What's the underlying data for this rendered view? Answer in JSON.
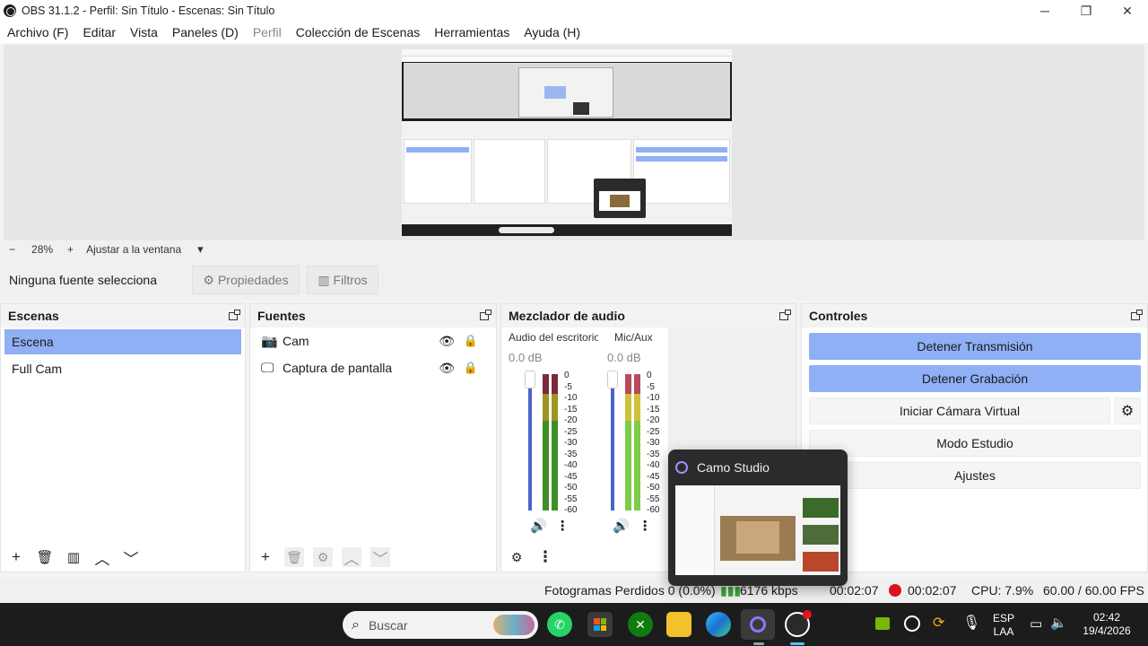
{
  "window": {
    "title": "OBS 31.1.2 - Perfil: Sin Título - Escenas: Sin Título",
    "minimize_glyph": "─",
    "maximize_glyph": "❐",
    "close_glyph": "✕"
  },
  "menu": [
    "Archivo (F)",
    "Editar",
    "Vista",
    "Paneles (D)",
    "Perfil",
    "Colección de Escenas",
    "Herramientas",
    "Ayuda (H)"
  ],
  "zoom": {
    "minus": "−",
    "value": "28%",
    "plus": "+",
    "fit_label": "Ajustar a la ventana",
    "dropdown_glyph": "▾"
  },
  "source_toolbar": {
    "label": "Ninguna fuente selecciona",
    "properties": "Propiedades",
    "filters": "Filtros"
  },
  "scenes": {
    "title": "Escenas",
    "items": [
      "Escena",
      "Full Cam"
    ],
    "selected_index": 0
  },
  "sources": {
    "title": "Fuentes",
    "items": [
      {
        "label": "Cam",
        "icon": "camera-icon"
      },
      {
        "label": "Captura de pantalla",
        "icon": "monitor-icon"
      }
    ]
  },
  "mixer": {
    "title": "Mezclador de audio",
    "channels": [
      {
        "name": "Audio del escritorio",
        "db": "0.0 dB"
      },
      {
        "name": "Mic/Aux",
        "db": "0.0 dB"
      }
    ],
    "scale": [
      "0",
      "-5",
      "-10",
      "-15",
      "-20",
      "-25",
      "-30",
      "-35",
      "-40",
      "-45",
      "-50",
      "-55",
      "-60"
    ]
  },
  "controls": {
    "title": "Controles",
    "stop_stream": "Detener Transmisión",
    "stop_record": "Detener Grabación",
    "start_virtual_cam": "Iniciar Cámara Virtual",
    "studio_mode": "Modo Estudio",
    "settings": "Ajustes"
  },
  "status": {
    "dropped_frames": "Fotogramas Perdidos 0 (0.0%)",
    "bitrate": "6176 kbps",
    "stream_time": "00:02:07",
    "rec_time": "00:02:07",
    "cpu": "CPU: 7.9%",
    "fps": "60.00 / 60.00 FPS"
  },
  "camo_popup": {
    "title": "Camo Studio"
  },
  "taskbar": {
    "search_placeholder": "Buscar",
    "lang_top": "ESP",
    "lang_bottom": "LAA",
    "time": "02:42",
    "date": "19/4/2026"
  },
  "colors": {
    "accent_selected": "#8fb0f5",
    "record_red": "#d9131f",
    "meter_green": "#3e8f25"
  }
}
